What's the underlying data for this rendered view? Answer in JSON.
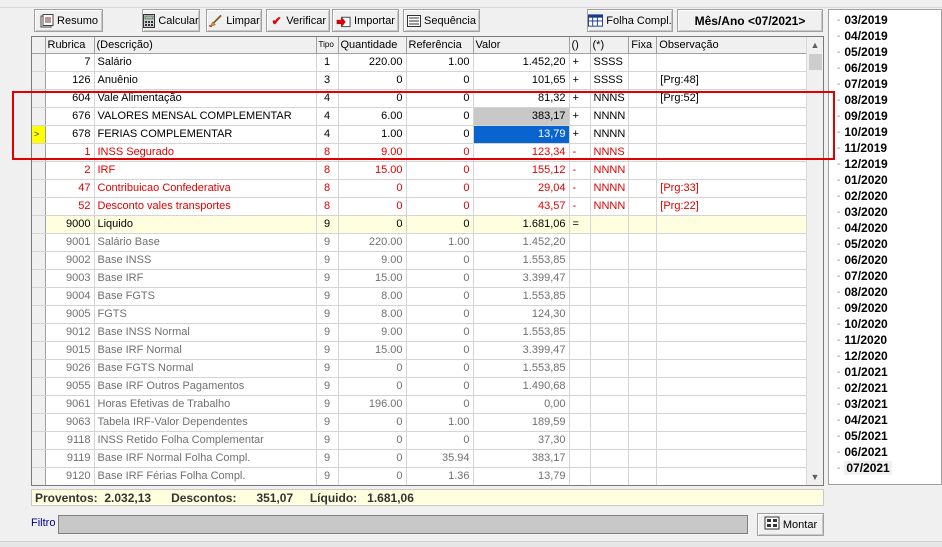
{
  "toolbar": {
    "resumo": "Resumo",
    "calcular": "Calcular",
    "limpar": "Limpar",
    "verificar": "Verificar",
    "importar": "Importar",
    "sequencia": "Sequência",
    "folha_compl": "Folha Compl.",
    "mes_ano": "Mês/Ano <07/2021>"
  },
  "grid": {
    "headers": {
      "rubrica": "Rubrica",
      "descricao": "(Descrição)",
      "tipo": "Tipo",
      "quantidade": "Quantidade",
      "referencia": "Referência",
      "valor": "Valor",
      "sinal": "()",
      "flags": "(*)",
      "fixa": "Fixa",
      "observacao": "Observação"
    },
    "rows": [
      {
        "rubrica": "7",
        "descricao": "Salário",
        "tipo": "1",
        "quantidade": "220.00",
        "referencia": "1.00",
        "valor": "1.452,20",
        "sinal": "+",
        "flags": "SSSS",
        "fixa": "",
        "observacao": ""
      },
      {
        "rubrica": "126",
        "descricao": "Anuênio",
        "tipo": "3",
        "quantidade": "0",
        "referencia": "0",
        "valor": "101,65",
        "sinal": "+",
        "flags": "SSSS",
        "fixa": "",
        "observacao": "[Prg:48]"
      },
      {
        "rubrica": "604",
        "descricao": "Vale Alimentação",
        "tipo": "4",
        "quantidade": "0",
        "referencia": "0",
        "valor": "81,32",
        "sinal": "+",
        "flags": "NNNS",
        "fixa": "",
        "observacao": "[Prg:52]"
      },
      {
        "rubrica": "676",
        "descricao": "VALORES MENSAL COMPLEMENTAR",
        "tipo": "4",
        "quantidade": "6.00",
        "referencia": "0",
        "valor": "383,17",
        "sinal": "+",
        "flags": "NNNN",
        "fixa": "",
        "observacao": ""
      },
      {
        "rubrica": "678",
        "descricao": "FERIAS COMPLEMENTAR",
        "tipo": "4",
        "quantidade": "1.00",
        "referencia": "0",
        "valor": "13,79",
        "sinal": "+",
        "flags": "NNNN",
        "fixa": "",
        "observacao": ""
      },
      {
        "rubrica": "1",
        "descricao": "INSS Segurado",
        "tipo": "8",
        "quantidade": "9.00",
        "referencia": "0",
        "valor": "123,34",
        "sinal": "-",
        "flags": "NNNS",
        "fixa": "",
        "observacao": ""
      },
      {
        "rubrica": "2",
        "descricao": "IRF",
        "tipo": "8",
        "quantidade": "15.00",
        "referencia": "0",
        "valor": "155,12",
        "sinal": "-",
        "flags": "NNNN",
        "fixa": "",
        "observacao": ""
      },
      {
        "rubrica": "47",
        "descricao": "Contribuicao Confederativa",
        "tipo": "8",
        "quantidade": "0",
        "referencia": "0",
        "valor": "29,04",
        "sinal": "-",
        "flags": "NNNN",
        "fixa": "",
        "observacao": "[Prg:33]"
      },
      {
        "rubrica": "52",
        "descricao": "Desconto vales transportes",
        "tipo": "8",
        "quantidade": "0",
        "referencia": "0",
        "valor": "43,57",
        "sinal": "-",
        "flags": "NNNN",
        "fixa": "",
        "observacao": "[Prg:22]"
      },
      {
        "rubrica": "9000",
        "descricao": "Liquido",
        "tipo": "9",
        "quantidade": "0",
        "referencia": "0",
        "valor": "1.681,06",
        "sinal": "=",
        "flags": "",
        "fixa": "",
        "observacao": ""
      },
      {
        "rubrica": "9001",
        "descricao": "Salário Base",
        "tipo": "9",
        "quantidade": "220.00",
        "referencia": "1.00",
        "valor": "1.452,20",
        "sinal": "",
        "flags": "",
        "fixa": "",
        "observacao": ""
      },
      {
        "rubrica": "9002",
        "descricao": "Base INSS",
        "tipo": "9",
        "quantidade": "9.00",
        "referencia": "0",
        "valor": "1.553,85",
        "sinal": "",
        "flags": "",
        "fixa": "",
        "observacao": ""
      },
      {
        "rubrica": "9003",
        "descricao": "Base IRF",
        "tipo": "9",
        "quantidade": "15.00",
        "referencia": "0",
        "valor": "3.399,47",
        "sinal": "",
        "flags": "",
        "fixa": "",
        "observacao": ""
      },
      {
        "rubrica": "9004",
        "descricao": "Base FGTS",
        "tipo": "9",
        "quantidade": "8.00",
        "referencia": "0",
        "valor": "1.553,85",
        "sinal": "",
        "flags": "",
        "fixa": "",
        "observacao": ""
      },
      {
        "rubrica": "9005",
        "descricao": "FGTS",
        "tipo": "9",
        "quantidade": "8.00",
        "referencia": "0",
        "valor": "124,30",
        "sinal": "",
        "flags": "",
        "fixa": "",
        "observacao": ""
      },
      {
        "rubrica": "9012",
        "descricao": "Base INSS Normal",
        "tipo": "9",
        "quantidade": "9.00",
        "referencia": "0",
        "valor": "1.553,85",
        "sinal": "",
        "flags": "",
        "fixa": "",
        "observacao": ""
      },
      {
        "rubrica": "9015",
        "descricao": "Base IRF Normal",
        "tipo": "9",
        "quantidade": "15.00",
        "referencia": "0",
        "valor": "3.399,47",
        "sinal": "",
        "flags": "",
        "fixa": "",
        "observacao": ""
      },
      {
        "rubrica": "9026",
        "descricao": "Base FGTS Normal",
        "tipo": "9",
        "quantidade": "0",
        "referencia": "0",
        "valor": "1.553,85",
        "sinal": "",
        "flags": "",
        "fixa": "",
        "observacao": ""
      },
      {
        "rubrica": "9055",
        "descricao": "Base IRF Outros Pagamentos",
        "tipo": "9",
        "quantidade": "0",
        "referencia": "0",
        "valor": "1.490,68",
        "sinal": "",
        "flags": "",
        "fixa": "",
        "observacao": ""
      },
      {
        "rubrica": "9061",
        "descricao": "Horas Efetivas de Trabalho",
        "tipo": "9",
        "quantidade": "196.00",
        "referencia": "0",
        "valor": "0,00",
        "sinal": "",
        "flags": "",
        "fixa": "",
        "observacao": ""
      },
      {
        "rubrica": "9063",
        "descricao": "Tabela IRF-Valor Dependentes",
        "tipo": "9",
        "quantidade": "0",
        "referencia": "1.00",
        "valor": "189,59",
        "sinal": "",
        "flags": "",
        "fixa": "",
        "observacao": ""
      },
      {
        "rubrica": "9118",
        "descricao": "INSS Retido Folha Complementar",
        "tipo": "9",
        "quantidade": "0",
        "referencia": "0",
        "valor": "37,30",
        "sinal": "",
        "flags": "",
        "fixa": "",
        "observacao": ""
      },
      {
        "rubrica": "9119",
        "descricao": "Base IRF Normal Folha Compl.",
        "tipo": "9",
        "quantidade": "0",
        "referencia": "35.94",
        "valor": "383,17",
        "sinal": "",
        "flags": "",
        "fixa": "",
        "observacao": ""
      },
      {
        "rubrica": "9120",
        "descricao": "Base IRF Férias Folha Compl.",
        "tipo": "9",
        "quantidade": "0",
        "referencia": "1.36",
        "valor": "13,79",
        "sinal": "",
        "flags": "",
        "fixa": "",
        "observacao": ""
      }
    ],
    "row_styles": [
      "normal",
      "normal",
      "normal",
      "normal",
      "normal",
      "red",
      "red",
      "red",
      "red",
      "liq",
      "gray",
      "gray",
      "gray",
      "gray",
      "gray",
      "gray",
      "gray",
      "gray",
      "gray",
      "gray",
      "gray",
      "gray",
      "gray",
      "gray"
    ],
    "current_row_marker": ">",
    "current_row_index": 4,
    "selected_value_row_index": 3
  },
  "totals": {
    "proventos_label": "Proventos:",
    "proventos": "2.032,13",
    "descontos_label": "Descontos:",
    "descontos": "351,07",
    "liquido_label": "Líquido:",
    "liquido": "1.681,06"
  },
  "filter": {
    "label": "Filtro",
    "value": "",
    "montar": "Montar"
  },
  "months": [
    "03/2019",
    "04/2019",
    "05/2019",
    "06/2019",
    "07/2019",
    "08/2019",
    "09/2019",
    "10/2019",
    "11/2019",
    "12/2019",
    "01/2020",
    "02/2020",
    "03/2020",
    "04/2020",
    "05/2020",
    "06/2020",
    "07/2020",
    "08/2020",
    "09/2020",
    "10/2020",
    "11/2020",
    "12/2020",
    "01/2021",
    "02/2021",
    "03/2021",
    "04/2021",
    "05/2021",
    "06/2021",
    "07/2021"
  ],
  "selected_month": "07/2021",
  "colors": {
    "discount_red": "#e00000",
    "memo_gray": "#707070",
    "liquid_row_bg": "#ffffe0",
    "current_marker_bg": "#ffff00",
    "selected_cell_bg": "#0a64d0",
    "annotation_box": "#e00000"
  }
}
